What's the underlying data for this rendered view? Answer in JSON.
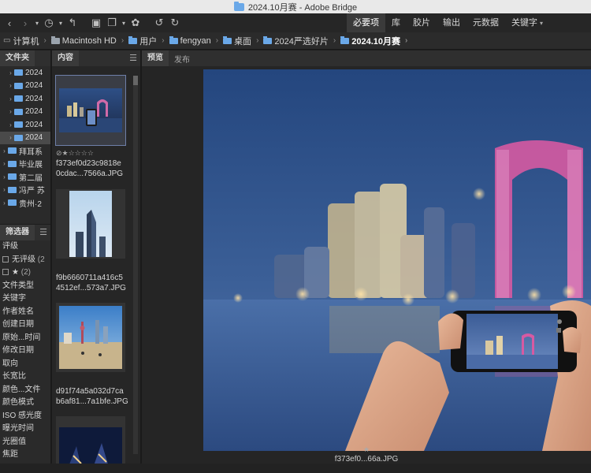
{
  "window": {
    "title": "2024.10月赛 - Adobe Bridge"
  },
  "toolbar": {
    "workspaces": [
      {
        "label": "必要项",
        "active": true
      },
      {
        "label": "库",
        "active": false
      },
      {
        "label": "胶片",
        "active": false
      },
      {
        "label": "输出",
        "active": false
      },
      {
        "label": "元数据",
        "active": false
      },
      {
        "label": "关键字",
        "active": false
      }
    ]
  },
  "breadcrumb": [
    {
      "label": "计算机",
      "icon": "computer-icon"
    },
    {
      "label": "Macintosh HD",
      "icon": "disk-icon"
    },
    {
      "label": "用户",
      "icon": "folder-icon"
    },
    {
      "label": "fengyan",
      "icon": "folder-icon"
    },
    {
      "label": "桌面",
      "icon": "folder-icon"
    },
    {
      "label": "2024严选好片",
      "icon": "folder-icon"
    },
    {
      "label": "2024.10月赛",
      "icon": "folder-icon"
    }
  ],
  "panels": {
    "folders_tab": "文件夹",
    "content_tab": "内容",
    "preview_tab": "预览",
    "publish_tab": "发布",
    "filter_tab": "筛选器"
  },
  "folders": [
    {
      "label": "2024",
      "indent": 1
    },
    {
      "label": "2024",
      "indent": 1
    },
    {
      "label": "2024",
      "indent": 1
    },
    {
      "label": "2024",
      "indent": 1
    },
    {
      "label": "2024",
      "indent": 1
    },
    {
      "label": "2024",
      "indent": 1,
      "selected": true
    },
    {
      "label": "拜耳系",
      "indent": 0
    },
    {
      "label": "毕业展",
      "indent": 0
    },
    {
      "label": "第二届",
      "indent": 0
    },
    {
      "label": "冯严 苏",
      "indent": 0
    },
    {
      "label": "贵州·2",
      "indent": 0
    }
  ],
  "filters": [
    {
      "label": "评级",
      "type": "heading"
    },
    {
      "label": "无评级",
      "count": "(2",
      "type": "check"
    },
    {
      "label": "★",
      "count": "(2)",
      "type": "check"
    },
    {
      "label": "文件类型",
      "type": "heading"
    },
    {
      "label": "关键字",
      "type": "heading"
    },
    {
      "label": "作者姓名",
      "type": "heading"
    },
    {
      "label": "创建日期",
      "type": "heading"
    },
    {
      "label": "原始...时间",
      "type": "heading"
    },
    {
      "label": "修改日期",
      "type": "heading"
    },
    {
      "label": "取向",
      "type": "heading"
    },
    {
      "label": "长宽比",
      "type": "heading"
    },
    {
      "label": "颜色...文件",
      "type": "heading"
    },
    {
      "label": "颜色模式",
      "type": "heading"
    },
    {
      "label": "ISO 感光度",
      "type": "heading"
    },
    {
      "label": "曝光时间",
      "type": "heading"
    },
    {
      "label": "光圈值",
      "type": "heading"
    },
    {
      "label": "焦距",
      "type": "heading"
    }
  ],
  "thumbnails": [
    {
      "line1": "f373ef0d23c9818e",
      "line2": "0cdac...7566a.JPG",
      "rating": "⊘★☆☆☆☆",
      "selected": true
    },
    {
      "line1": "f9b6660711a416c5",
      "line2": "4512ef...573a7.JPG",
      "rating": "",
      "selected": false
    },
    {
      "line1": "d91f74a5a032d7ca",
      "line2": "b6af81...7a1bfe.JPG",
      "rating": "",
      "selected": false
    }
  ],
  "preview": {
    "star": "★",
    "caption": "f373ef0...66a.JPG"
  }
}
